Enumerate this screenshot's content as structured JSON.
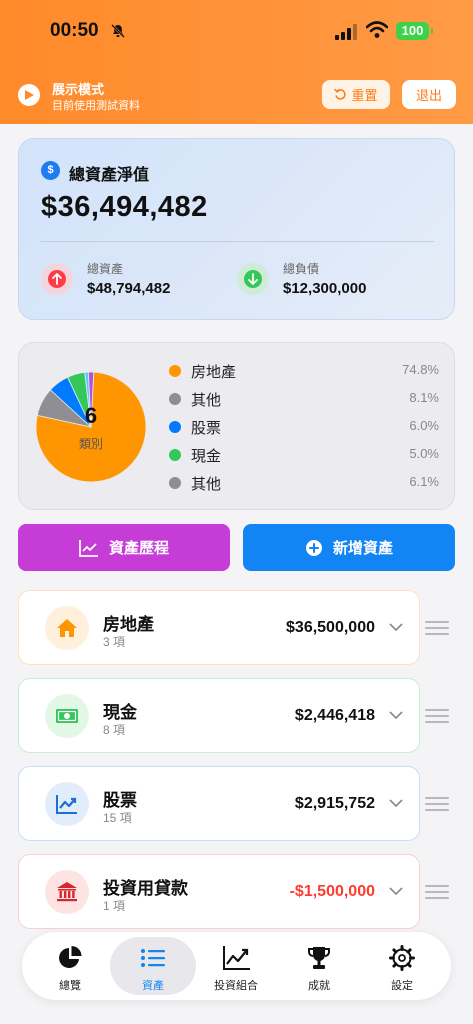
{
  "status": {
    "time": "00:50",
    "battery": "100"
  },
  "demo": {
    "title": "展示模式",
    "subtitle": "目前使用測試資料",
    "reset_label": "重置",
    "exit_label": "退出"
  },
  "net_worth": {
    "title": "總資產淨值",
    "value": "$36,494,482",
    "total_assets_label": "總資產",
    "total_assets_value": "$48,794,482",
    "total_liabilities_label": "總負債",
    "total_liabilities_value": "$12,300,000"
  },
  "categories": {
    "count": "6",
    "unit": "類別",
    "items": [
      {
        "name": "房地產",
        "percent": "74.8%",
        "value": 74.8,
        "color": "#ff9500"
      },
      {
        "name": "其他",
        "percent": "8.1%",
        "value": 8.1,
        "color": "#8e8e93"
      },
      {
        "name": "股票",
        "percent": "6.0%",
        "value": 6.0,
        "color": "#007aff"
      },
      {
        "name": "現金",
        "percent": "5.0%",
        "value": 5.0,
        "color": "#34c759"
      },
      {
        "name": "其他",
        "percent": "6.1%",
        "value": 6.1,
        "color": "#8e8e93"
      }
    ],
    "pie_extra": [
      {
        "value": 1.0,
        "color": "#5ac8fa"
      },
      {
        "value": 1.5,
        "color": "#af52de"
      }
    ]
  },
  "actions": {
    "history_label": "資產歷程",
    "add_label": "新增資產"
  },
  "assets": [
    {
      "name": "房地產",
      "count": "3 項",
      "amount": "$36,500,000",
      "color": "#ff9500",
      "border": "#ffe2bd",
      "icon_bg": "#fff0dc",
      "icon": "house-icon"
    },
    {
      "name": "現金",
      "count": "8 項",
      "amount": "$2,446,418",
      "color": "#34c759",
      "border": "#c6efcf",
      "icon_bg": "#e3f7e7",
      "icon": "banknote-icon"
    },
    {
      "name": "股票",
      "count": "15 項",
      "amount": "$2,915,752",
      "color": "#007aff",
      "border": "#c7ddfa",
      "icon_bg": "#e2edfb",
      "icon": "chart-up-icon"
    },
    {
      "name": "投資用貸款",
      "count": "1 項",
      "amount": "-$1,500,000",
      "color": "#ff3b30",
      "border": "#fbd0cd",
      "icon_bg": "#fde4e2",
      "icon": "bank-icon"
    }
  ],
  "tabs": [
    {
      "label": "總覽",
      "icon": "pie-chart-icon"
    },
    {
      "label": "資產",
      "icon": "list-icon"
    },
    {
      "label": "投資組合",
      "icon": "line-chart-icon"
    },
    {
      "label": "成就",
      "icon": "trophy-icon"
    },
    {
      "label": "設定",
      "icon": "gear-icon"
    }
  ],
  "colors": {
    "accent": "#ff8a2a",
    "primary": "#1384f4",
    "history": "#c53cd6",
    "negative": "#ff3b30"
  }
}
